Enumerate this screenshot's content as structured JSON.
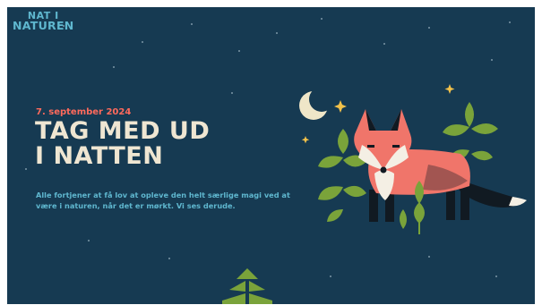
{
  "logo": {
    "line1": "NAT I",
    "line2": "NATUREN"
  },
  "hero": {
    "date": "7. september 2024",
    "headline_line1": "TAG MED UD",
    "headline_line2": "I NATTEN",
    "body": "Alle fortjener at få lov at opleve den helt særlige magi ved at være i naturen, når det er mørkt. Vi ses derude."
  },
  "colors": {
    "background": "#163a52",
    "accent_red": "#ff6a5c",
    "headline": "#efe6d2",
    "body_text": "#5fb7cf",
    "leaf_green": "#7aa33a",
    "fox_coral": "#f0756a",
    "moon": "#efe6c8"
  },
  "icons": [
    "moon-icon",
    "star-icon",
    "fox-illustration",
    "leaf-icon",
    "tree-logo-icon"
  ]
}
